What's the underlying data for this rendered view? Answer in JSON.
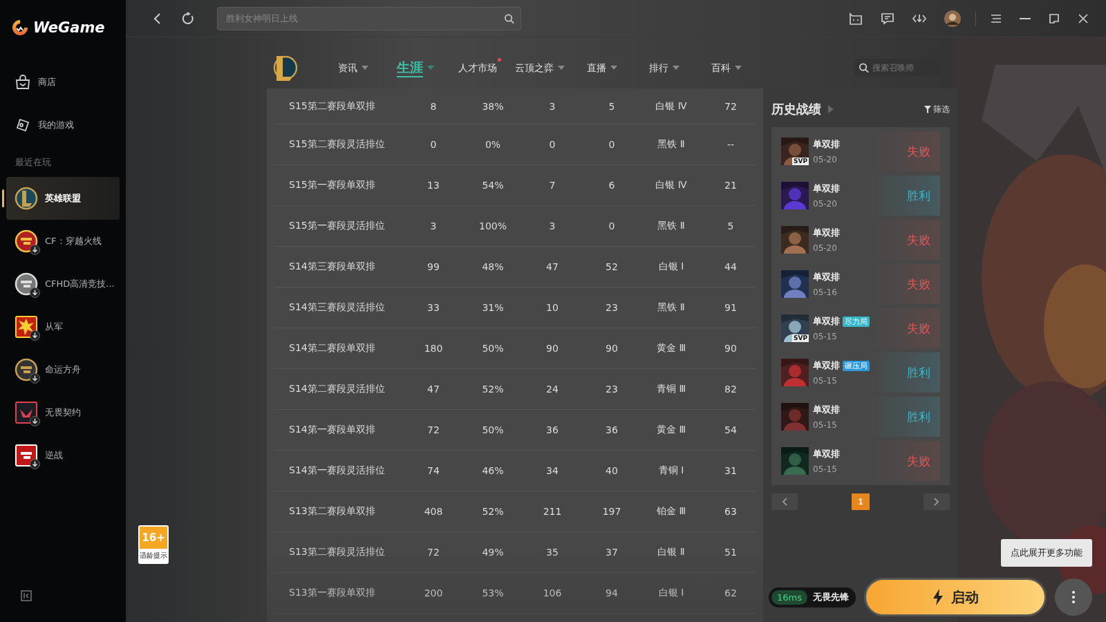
{
  "brand": "WeGame",
  "search": {
    "placeholder": "胜利女神明日上线"
  },
  "sidebar": {
    "main_items": [
      {
        "label": "商店",
        "kind": "store",
        "selected": false
      },
      {
        "label": "我的游戏",
        "kind": "games",
        "selected": false
      }
    ],
    "recent_heading": "最近在玩",
    "recent": [
      {
        "label": "英雄联盟",
        "selected": true,
        "download": false
      },
      {
        "label": "CF：穿越火线",
        "selected": false,
        "download": true
      },
      {
        "label": "CFHD高清竞技...",
        "selected": false,
        "download": true
      },
      {
        "label": "从军",
        "selected": false,
        "download": true
      },
      {
        "label": "命运方舟",
        "selected": false,
        "download": true
      },
      {
        "label": "无畏契约",
        "selected": false,
        "download": true
      },
      {
        "label": "逆战",
        "selected": false,
        "download": true
      }
    ]
  },
  "nav": {
    "tabs": [
      {
        "label": "资讯",
        "selected": false,
        "dropdown": true,
        "dot": false
      },
      {
        "label": "生涯",
        "selected": true,
        "dropdown": true,
        "dot": false
      },
      {
        "label": "人才市场",
        "selected": false,
        "dropdown": false,
        "dot": true
      },
      {
        "label": "云顶之弈",
        "selected": false,
        "dropdown": true,
        "dot": false
      },
      {
        "label": "直播",
        "selected": false,
        "dropdown": true,
        "dot": false
      },
      {
        "label": "排行",
        "selected": false,
        "dropdown": true,
        "dot": false
      },
      {
        "label": "百科",
        "selected": false,
        "dropdown": true,
        "dot": false
      }
    ],
    "summoner_search": {
      "placeholder": "搜索召唤师"
    }
  },
  "table": {
    "rows": [
      [
        "S15第二赛段单双排",
        "8",
        "38%",
        "3",
        "5",
        "白银 Ⅳ",
        "72"
      ],
      [
        "S15第二赛段灵活排位",
        "0",
        "0%",
        "0",
        "0",
        "黑铁 Ⅱ",
        "--"
      ],
      [
        "S15第一赛段单双排",
        "13",
        "54%",
        "7",
        "6",
        "白银 Ⅳ",
        "21"
      ],
      [
        "S15第一赛段灵活排位",
        "3",
        "100%",
        "3",
        "0",
        "黑铁 Ⅱ",
        "5"
      ],
      [
        "S14第三赛段单双排",
        "99",
        "48%",
        "47",
        "52",
        "白银 Ⅰ",
        "44"
      ],
      [
        "S14第三赛段灵活排位",
        "33",
        "31%",
        "10",
        "23",
        "黑铁 Ⅱ",
        "91"
      ],
      [
        "S14第二赛段单双排",
        "180",
        "50%",
        "90",
        "90",
        "黄金 Ⅲ",
        "90"
      ],
      [
        "S14第二赛段灵活排位",
        "47",
        "52%",
        "24",
        "23",
        "青铜 Ⅲ",
        "82"
      ],
      [
        "S14第一赛段单双排",
        "72",
        "50%",
        "36",
        "36",
        "黄金 Ⅲ",
        "54"
      ],
      [
        "S14第一赛段灵活排位",
        "74",
        "46%",
        "34",
        "40",
        "青铜 Ⅰ",
        "31"
      ],
      [
        "S13第二赛段单双排",
        "408",
        "52%",
        "211",
        "197",
        "铂金 Ⅲ",
        "63"
      ],
      [
        "S13第二赛段灵活排位",
        "72",
        "49%",
        "35",
        "37",
        "白银 Ⅱ",
        "51"
      ],
      [
        "S13第一赛段单双排",
        "200",
        "53%",
        "106",
        "94",
        "白银 Ⅰ",
        "62"
      ]
    ]
  },
  "history": {
    "title": "历史战绩",
    "filter": "筛选",
    "matches": [
      {
        "mode": "单双排",
        "date": "05-20",
        "badge": "SVP",
        "result": "失败",
        "win": false
      },
      {
        "mode": "单双排",
        "date": "05-20",
        "result": "胜利",
        "win": true
      },
      {
        "mode": "单双排",
        "date": "05-20",
        "result": "失败",
        "win": false
      },
      {
        "mode": "单双排",
        "date": "05-16",
        "result": "失败",
        "win": false
      },
      {
        "mode": "单双排",
        "date": "05-15",
        "badge": "SVP",
        "tag": {
          "label": "尽力局",
          "color": "#33b8cc"
        },
        "result": "失败",
        "win": false
      },
      {
        "mode": "单双排",
        "date": "05-15",
        "tag": {
          "label": "碾压局",
          "color": "#2a98dc"
        },
        "result": "胜利",
        "win": true
      },
      {
        "mode": "单双排",
        "date": "05-15",
        "result": "胜利",
        "win": true
      },
      {
        "mode": "单双排",
        "date": "05-15",
        "result": "失败",
        "win": false
      }
    ],
    "pages": [
      {
        "label": "1",
        "selected": true
      }
    ]
  },
  "age_badge": {
    "rating": "16+",
    "caption": "适龄提示"
  },
  "launch": {
    "ping": "16ms",
    "accelerator": "无畏先锋",
    "button": "启动",
    "tooltip": "点此展开更多功能"
  }
}
